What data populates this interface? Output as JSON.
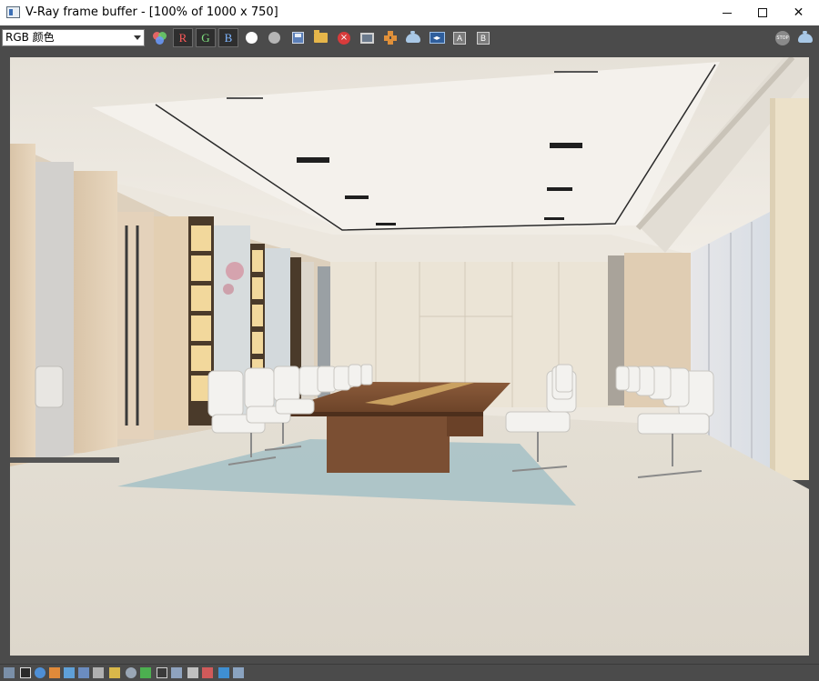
{
  "window": {
    "title": "V-Ray frame buffer - [100% of 1000 x 750]",
    "icon": "vray-frame-buffer-icon"
  },
  "window_controls": {
    "minimize": "minimize-icon",
    "maximize": "maximize-icon",
    "close_glyph": "✕"
  },
  "toolbar": {
    "channel": "RGB 颜色",
    "r_label": "R",
    "g_label": "G",
    "b_label": "B",
    "clear_glyph": "×",
    "stop_label": "STOP",
    "split_glyph": "◂▸",
    "ab_a": "A",
    "ab_b": "B",
    "icons": [
      "color-channels-icon",
      "white-display-icon",
      "gray-display-icon",
      "save-image-icon",
      "load-image-icon",
      "clear-image-icon",
      "duplicate-to-mwb-icon",
      "region-render-icon",
      "render-teapot-icon",
      "compare-split-icon",
      "compare-a-icon",
      "compare-b-icon",
      "stop-render-icon",
      "render-last-teapot-icon"
    ]
  },
  "render": {
    "zoom": "100%",
    "resolution": "1000 x 750",
    "content": "conference-room-render-image"
  },
  "statusbar": {
    "icons": [
      "show-corrections-icon",
      "pixel-info-icon",
      "exposure-icon",
      "white-balance-icon",
      "hsv-icon",
      "color-balance-icon",
      "levels-icon",
      "curve-icon",
      "background-image-icon",
      "lut-icon",
      "ocio-icon",
      "display-srgb-icon",
      "histogram-icon",
      "lens-effects-icon",
      "stamp-icon",
      "history-icon"
    ]
  },
  "colors": {
    "titlebar": "#ffffff",
    "toolbar": "#4b4b4b",
    "viewport": "#4b4b4b",
    "accent_red": "#ff5a5a",
    "accent_green": "#7fe07f",
    "accent_blue": "#7fb6ff"
  }
}
